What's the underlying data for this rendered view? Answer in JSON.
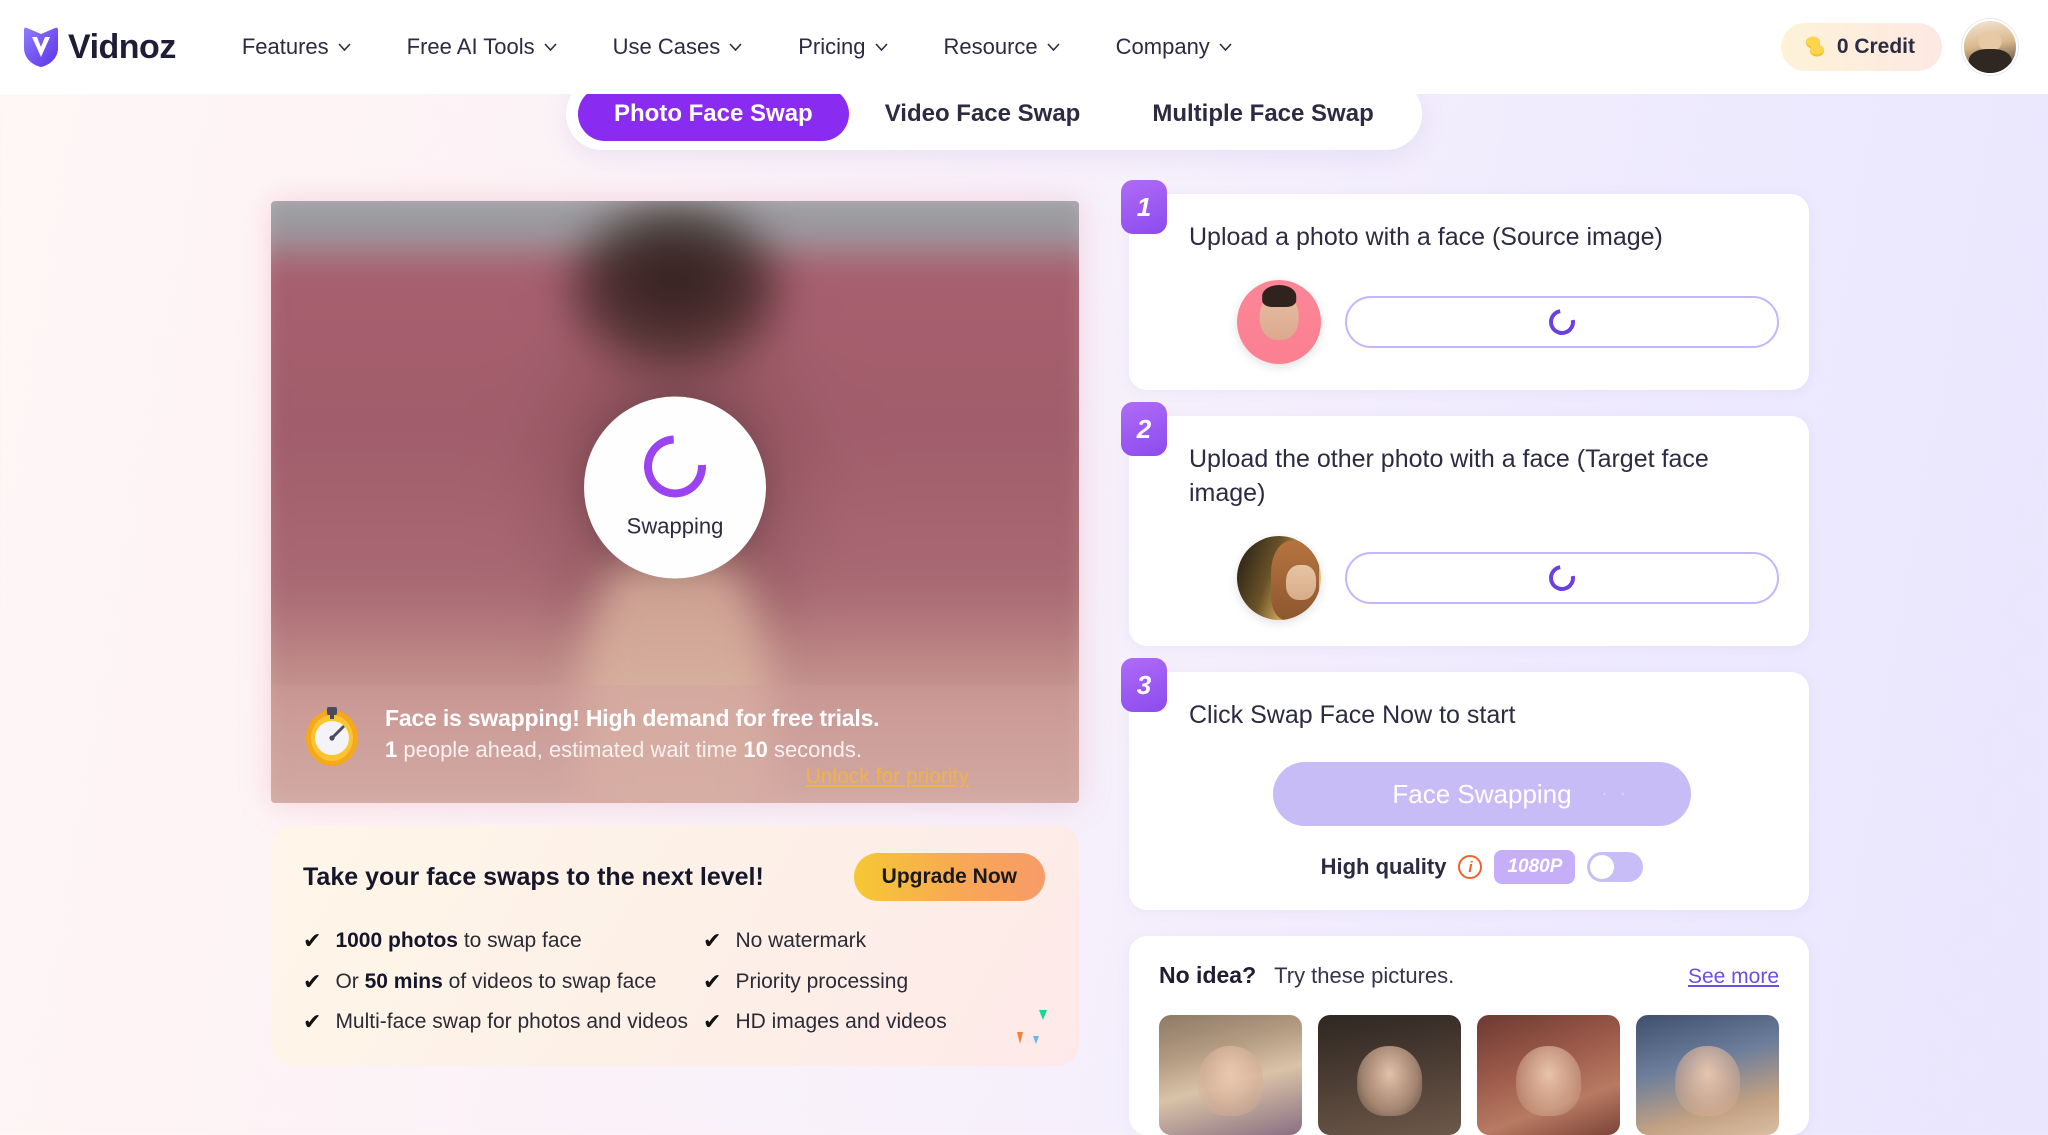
{
  "header": {
    "logo_text": "Vidnoz",
    "nav": [
      {
        "label": "Features"
      },
      {
        "label": "Free AI Tools"
      },
      {
        "label": "Use Cases"
      },
      {
        "label": "Pricing"
      },
      {
        "label": "Resource"
      },
      {
        "label": "Company"
      }
    ],
    "credit_label": "0 Credit"
  },
  "tabs": [
    {
      "label": "Photo Face Swap",
      "active": true
    },
    {
      "label": "Video Face Swap",
      "active": false
    },
    {
      "label": "Multiple Face Swap",
      "active": false
    }
  ],
  "preview": {
    "spinner_label": "Swapping",
    "banner_title": "Face is swapping! High demand for free trials.",
    "banner_count": "1",
    "banner_mid": " people ahead, estimated wait time ",
    "banner_seconds": "10",
    "banner_end": " seconds.",
    "unlock_label": "Unlock for priority"
  },
  "promo": {
    "title": "Take your face swaps to the next level!",
    "upgrade_label": "Upgrade Now",
    "items_left": [
      {
        "strong": "1000 photos",
        "rest": " to swap face"
      },
      {
        "pre": "Or ",
        "strong": "50 mins",
        "rest": " of videos to swap face"
      },
      {
        "strong": "",
        "rest": "Multi-face swap for photos and videos"
      }
    ],
    "items_right": [
      {
        "rest": "No watermark"
      },
      {
        "rest": "Priority processing"
      },
      {
        "rest": "HD images and videos"
      }
    ]
  },
  "steps": [
    {
      "number": "1",
      "title": "Upload a photo with a face (Source image)"
    },
    {
      "number": "2",
      "title": "Upload the other photo with a face (Target face image)"
    },
    {
      "number": "3",
      "title": "Click Swap Face Now to start"
    }
  ],
  "action": {
    "swap_button_label": "Face Swapping",
    "swap_dots": "· ·",
    "quality_label": "High quality",
    "info_glyph": "i",
    "resolution_badge": "1080P",
    "toggle_state": "off"
  },
  "ideas": {
    "title": "No idea?",
    "subtitle": "Try these pictures.",
    "see_more_label": "See more",
    "thumbs": [
      {
        "name": "fantasy-crown-portrait"
      },
      {
        "name": "dark-warrior-portrait"
      },
      {
        "name": "santa-hat-portrait"
      },
      {
        "name": "blonde-smiling-portrait"
      }
    ]
  },
  "colors": {
    "accent_purple": "#8a2bf2",
    "badge_purple": "#8b4bf0",
    "orange": "#f2612c",
    "link_gold": "#f0b24a"
  }
}
